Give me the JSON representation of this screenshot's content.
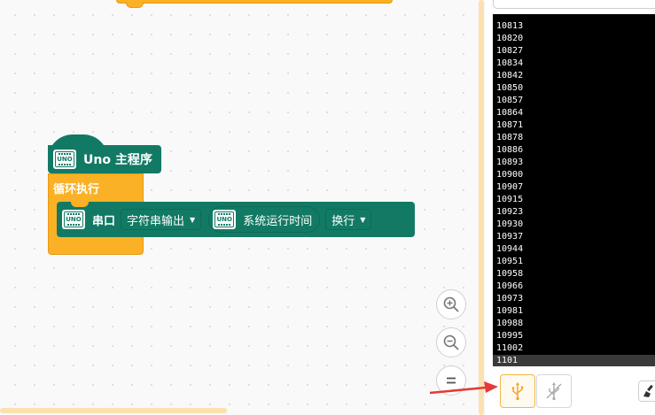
{
  "blocks": {
    "main_hat": {
      "label": "Uno 主程序"
    },
    "loop": {
      "label": "循环执行"
    },
    "serial": {
      "label": "串口",
      "mode_dropdown": "字符串输出",
      "reporter_label": "系统运行时间",
      "newline_dropdown": "换行"
    }
  },
  "zoom_controls": {
    "zoom_in_icon": "zoom-in-icon",
    "zoom_out_icon": "zoom-out-icon",
    "reset_icon": "equals-icon"
  },
  "serial_monitor": {
    "lines": [
      "10813",
      "10820",
      "10827",
      "10834",
      "10842",
      "10850",
      "10857",
      "10864",
      "10871",
      "10878",
      "10886",
      "10893",
      "10900",
      "10907",
      "10915",
      "10923",
      "10930",
      "10937",
      "10944",
      "10951",
      "10958",
      "10966",
      "10973",
      "10981",
      "10988",
      "10995",
      "11002",
      "1101"
    ]
  },
  "controls": {
    "connect_icon": "usb-icon",
    "disconnect_icon": "usb-disconnected-icon",
    "clear_icon": "broom-icon"
  },
  "colors": {
    "block_green": "#127a64",
    "block_orange": "#fbb126",
    "annotation_arrow": "#e53935",
    "usb_active": "#f0a020"
  }
}
